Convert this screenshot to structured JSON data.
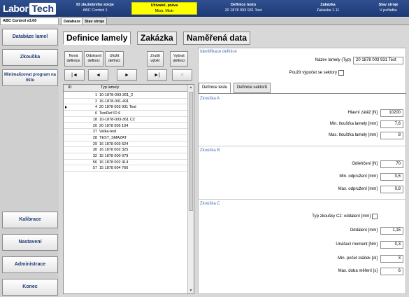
{
  "header": {
    "logo_labor": "Labor",
    "logo_tech": "Tech",
    "cells": [
      {
        "title": "ID zkušebního stroje",
        "value": "ABC Control 1"
      },
      {
        "title": "Uživatel, práva",
        "value": "Mistr, Mistr"
      },
      {
        "title": "Definice testu",
        "value": "20 1878 003 931 Test"
      },
      {
        "title": "Zakázka",
        "value": "Zakázka 1.11"
      },
      {
        "title": "Stav stroje",
        "value": "V pořádku"
      }
    ],
    "user_color": "#ffff00"
  },
  "version": "ABC Control v3.00",
  "top_tabs": [
    "Databáze",
    "Stav stroje"
  ],
  "nav": {
    "top": [
      "Databáze lamel",
      "Zkouška",
      "Minimalizovat program na lištu"
    ],
    "bottom": [
      "Kalibrace",
      "Nastavení",
      "Administrace",
      "Konec"
    ]
  },
  "title_tabs": [
    "Definice lamely",
    "Zakázka",
    "Naměřená data"
  ],
  "toolbar": {
    "buttons": [
      "Nová definice",
      "Odstranit definici",
      "Uložit definici",
      "Zrušit výběr",
      "Vybrat definici"
    ],
    "nav": [
      "|◄",
      "◄",
      "►",
      "►|",
      "✕"
    ]
  },
  "list": {
    "columns": [
      "ID",
      "Typ lamely"
    ],
    "rows": [
      {
        "id": "1",
        "name": "10-1878-003-361_2"
      },
      {
        "id": "2",
        "name": "16-1878-001-491"
      },
      {
        "id": "4",
        "name": "20 1878 003 931 Test"
      },
      {
        "id": "6",
        "name": "TestDef ID 6"
      },
      {
        "id": "18",
        "name": "10-1878-003-361  C2"
      },
      {
        "id": "20",
        "name": "20 1878 005 104"
      },
      {
        "id": "27",
        "name": "Velka-test"
      },
      {
        "id": "28",
        "name": "TEST_SMAZAT"
      },
      {
        "id": "29",
        "name": "16 1878 003 624"
      },
      {
        "id": "30",
        "name": "16 1878 002 325"
      },
      {
        "id": "32",
        "name": "15 1878 000 979"
      },
      {
        "id": "56",
        "name": "16 1878 002 414"
      },
      {
        "id": "57",
        "name": "15 1878 004 766"
      }
    ],
    "selected_index": 2
  },
  "identification": {
    "group_title": "Identifikace definice",
    "name_label": "Název lamely (Typ)",
    "name_value": "20 1878 003 931 Test",
    "sectors_label": "Použít výpočet se sektory"
  },
  "sub_tabs": [
    "Definice testu",
    "Definice sektorů"
  ],
  "zkouska_a": {
    "title": "Zkouška A",
    "fields": [
      {
        "label": "Hlavní zátěž [N]",
        "value": "10200"
      },
      {
        "label": "Min. tloušťka lamely [mm]",
        "value": "7,6"
      },
      {
        "label": "Max. tloušťka lamely [mm]",
        "value": "8"
      }
    ]
  },
  "zkouska_b": {
    "title": "Zkouška B",
    "fields": [
      {
        "label": "Odlehčení [N]",
        "value": "70"
      },
      {
        "label": "Min. odpružení [mm]",
        "value": "0,6"
      },
      {
        "label": "Max. odpružení [mm]",
        "value": "0,8"
      }
    ]
  },
  "zkouska_c": {
    "title": "Zkouška C",
    "check_label": "Typ zkoušky C2: oddálení  [mm]",
    "fields": [
      {
        "label": "Oddálení [mm]",
        "value": "1,15"
      },
      {
        "label": "Unášecí moment [Nm]",
        "value": "0,3"
      },
      {
        "label": "Min. počet otáček [ot]",
        "value": "3"
      },
      {
        "label": "Max. doba měření [s]",
        "value": "6"
      }
    ]
  }
}
